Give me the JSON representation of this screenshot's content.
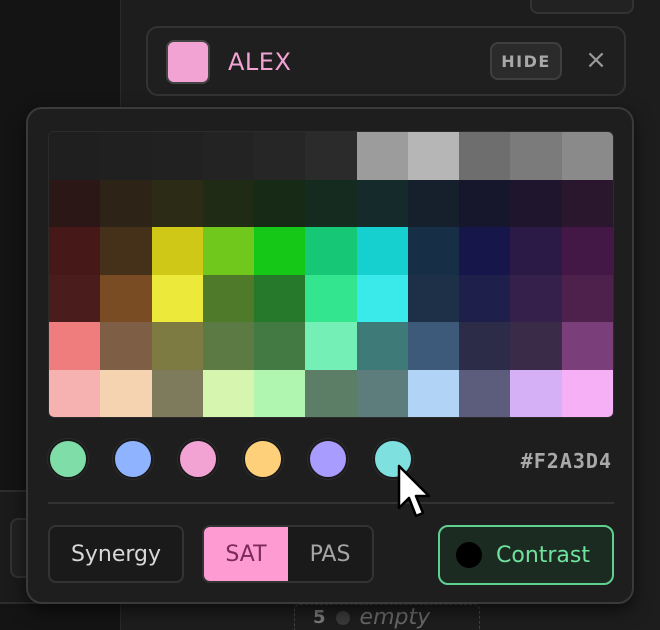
{
  "player": {
    "name": "ALEX",
    "color": "#F2A3D4",
    "hide_label": "HIDE",
    "close_glyph": "×"
  },
  "picker": {
    "grid_colors": [
      [
        "#1f1f1f",
        "#202020",
        "#212121",
        "#232323",
        "#262626",
        "#2b2b2b",
        "#9c9c9c",
        "#b6b6b6",
        "#6e6e6e",
        "#7b7b7b",
        "#8a8a8a"
      ],
      [
        "#2c1717",
        "#2e2317",
        "#2c2b15",
        "#1f2b15",
        "#162a15",
        "#152b20",
        "#152b2b",
        "#16202d",
        "#16162d",
        "#1f162d",
        "#2a162d"
      ],
      [
        "#461818",
        "#45301a",
        "#d0c816",
        "#6fc81b",
        "#15c818",
        "#16c876",
        "#16d0d0",
        "#162e46",
        "#16164a",
        "#2c1a46",
        "#441846"
      ],
      [
        "#4a1c1c",
        "#7a4c24",
        "#ece93a",
        "#4e7a2a",
        "#26792a",
        "#33e58e",
        "#3aeaea",
        "#1d3048",
        "#1f1f4c",
        "#34204a",
        "#4e204c"
      ],
      [
        "#f07d7d",
        "#7e5e44",
        "#7e7b42",
        "#5c7a44",
        "#437a44",
        "#74f0b6",
        "#3e7a78",
        "#3e5a7a",
        "#2c2c48",
        "#3a2c48",
        "#7a3e7a",
        "#f07ab6"
      ],
      [
        "#f6b2b0",
        "#f6d3b0",
        "#7d7b5c",
        "#d6f6b0",
        "#b0f6b0",
        "#5c7d66",
        "#5c7d7b",
        "#b0d3f6",
        "#5c5c7d",
        "#d6b0f6",
        "#f6b0f6",
        "#7d5c6e"
      ]
    ],
    "recent_colors": [
      "#7fdda8",
      "#8fb3ff",
      "#f2a3d4",
      "#ffd07a",
      "#a89cff",
      "#7fe0e0"
    ],
    "hex_label": "#F2A3D4",
    "synergy_label": "Synergy",
    "mode_sat_label": "SAT",
    "mode_pas_label": "PAS",
    "contrast_label": "Contrast"
  },
  "background": {
    "row_number": "5",
    "row_label": "empty"
  }
}
